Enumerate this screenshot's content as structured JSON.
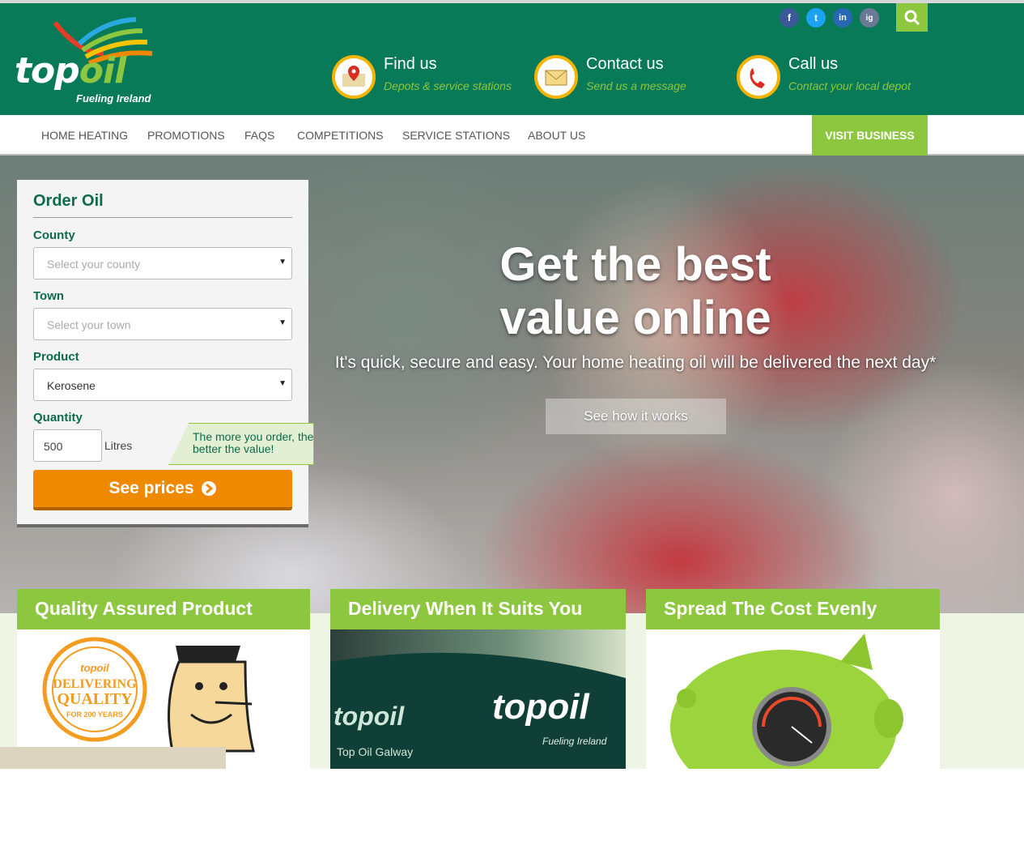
{
  "header": {
    "logo_word_top": "top",
    "logo_word_oil": "oil",
    "logo_tagline": "Fueling Ireland",
    "social": [
      "f",
      "t",
      "in",
      "ig"
    ],
    "items": [
      {
        "title": "Find us",
        "subtitle": "Depots & service stations",
        "icon": "map-pin-icon"
      },
      {
        "title": "Contact us",
        "subtitle": "Send us a message",
        "icon": "envelope-icon"
      },
      {
        "title": "Call us",
        "subtitle": "Contact your local depot",
        "icon": "phone-icon"
      }
    ]
  },
  "nav": {
    "items": [
      "HOME HEATING",
      "PROMOTIONS",
      "FAQS",
      "COMPETITIONS",
      "SERVICE STATIONS",
      "ABOUT US"
    ],
    "visit_business": "VISIT BUSINESS"
  },
  "order": {
    "title": "Order Oil",
    "county_label": "County",
    "county_value": "Select your county",
    "town_label": "Town",
    "town_value": "Select your town",
    "product_label": "Product",
    "product_value": "Kerosene",
    "quantity_label": "Quantity",
    "quantity_value": "500",
    "quantity_unit": "Litres",
    "tip": "The more you order, the better the value!",
    "submit": "See prices"
  },
  "hero": {
    "title": "Get the best value online",
    "subtitle": "It's quick, secure and easy. Your home heating oil will be delivered the next day*",
    "cta": "See how it works"
  },
  "features": [
    {
      "title": "Quality Assured Product",
      "badge_brand": "topoil",
      "badge_line1": "DELIVERING",
      "badge_line2": "QUALITY",
      "badge_line3": "FOR 200 YEARS"
    },
    {
      "title": "Delivery When It Suits You",
      "truck_brand": "topoil",
      "truck_text": "Top Oil Galway",
      "truck_tag": "Fueling Ireland"
    },
    {
      "title": "Spread The Cost Evenly"
    }
  ],
  "colors": {
    "brand_green": "#087a58",
    "accent_green": "#8dc63f",
    "cta_orange": "#ef8a00"
  }
}
